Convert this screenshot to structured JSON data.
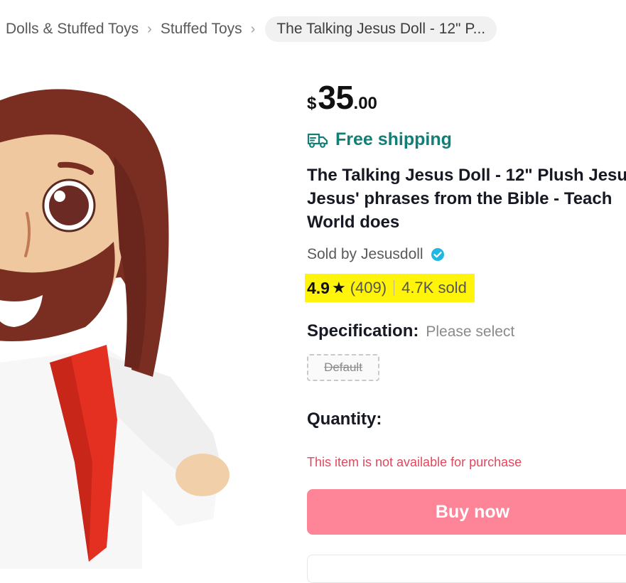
{
  "breadcrumb": {
    "items": [
      "Dolls & Stuffed Toys",
      "Stuffed Toys"
    ],
    "current": "The Talking Jesus Doll - 12\" P...",
    "separator": ">"
  },
  "product": {
    "image_alt": "plush-doll-image",
    "price": {
      "currency": "$",
      "whole": "35",
      "cents": ".00"
    },
    "shipping": "Free shipping",
    "title_lines": [
      "The Talking Jesus Doll - 12\" Plush Jesu",
      "Jesus' phrases from the Bible - Teach",
      "World does"
    ],
    "seller_prefix": "Sold by",
    "seller_name": "Jesusdoll",
    "rating": {
      "score": "4.9",
      "star": "★",
      "count": "(409)",
      "sold": "4.7K sold",
      "highlight_color": "#fff40a"
    },
    "spec": {
      "label": "Specification:",
      "hint": "Please select",
      "option": "Default"
    },
    "quantity_label": "Quantity:",
    "unavailable_text": "This item is not available for purchase",
    "buy_button": "Buy now"
  },
  "colors": {
    "shipping": "#127e76",
    "buy_button": "#fe8597",
    "unavailable": "#e0485e",
    "verified": "#20b8e3"
  }
}
